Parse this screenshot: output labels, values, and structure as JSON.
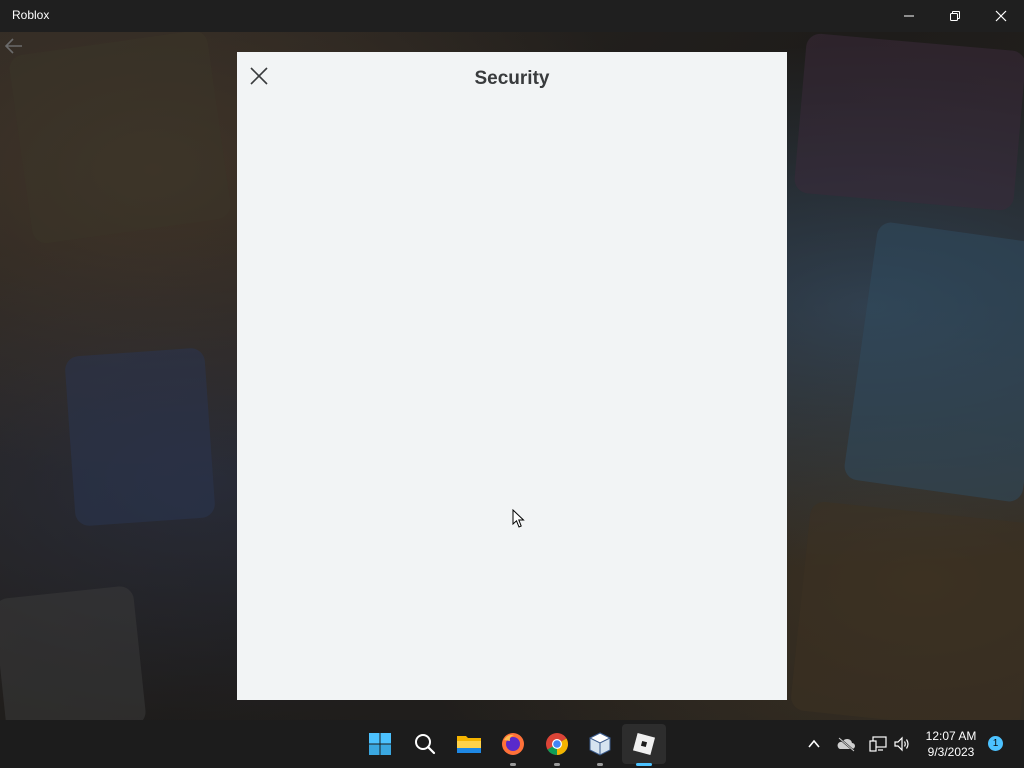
{
  "window": {
    "title": "Roblox",
    "controls": {
      "minimize_icon": "minimize-icon",
      "maximize_icon": "restore-icon",
      "close_icon": "close-icon"
    }
  },
  "navigation": {
    "back_icon": "back-arrow-icon"
  },
  "dialog": {
    "title": "Security",
    "close_icon": "close-icon"
  },
  "taskbar": {
    "apps": [
      {
        "name": "Start",
        "icon": "windows-start-icon"
      },
      {
        "name": "Search",
        "icon": "search-icon"
      },
      {
        "name": "File Explorer",
        "icon": "folder-icon"
      },
      {
        "name": "Firefox",
        "icon": "firefox-icon"
      },
      {
        "name": "Chrome",
        "icon": "chrome-icon"
      },
      {
        "name": "VirtualBox",
        "icon": "virtualbox-icon"
      },
      {
        "name": "Roblox",
        "icon": "roblox-icon",
        "active": true
      }
    ],
    "tray": {
      "overflow_icon": "chevron-up-icon",
      "cloud_icon": "onedrive-offline-icon",
      "network_icon": "network-icon",
      "volume_icon": "volume-icon"
    },
    "clock": {
      "time": "12:07 AM",
      "date": "9/3/2023"
    },
    "notification_count": "1"
  },
  "colors": {
    "dialog_background": "#f2f4f5",
    "dialog_title": "#393b3d",
    "taskbar": "#1c1c1c",
    "accent": "#4cc2ff"
  }
}
